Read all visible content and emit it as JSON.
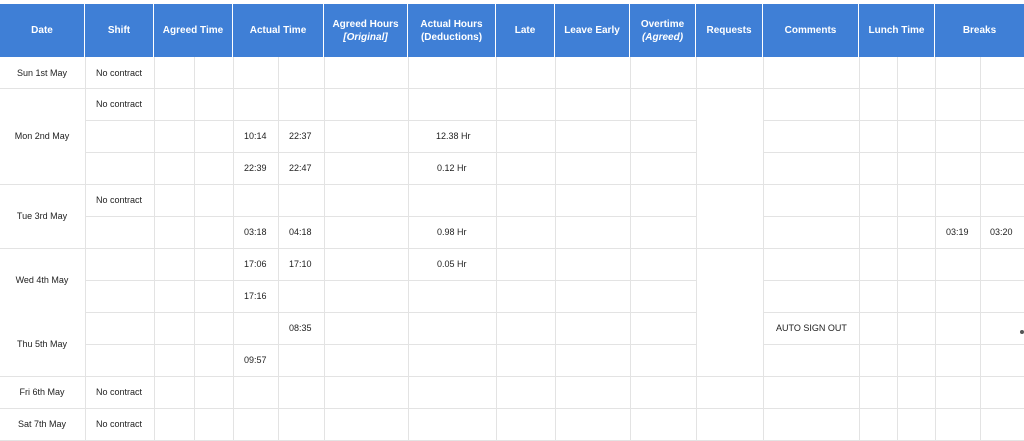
{
  "headers": {
    "date": "Date",
    "shift": "Shift",
    "agreed_time": "Agreed Time",
    "actual_time": "Actual Time",
    "agreed_hours": "Agreed Hours",
    "agreed_hours_sub": "[Original]",
    "actual_hours": "Actual Hours",
    "actual_hours_sub": "(Deductions)",
    "late": "Late",
    "leave_early": "Leave Early",
    "overtime": "Overtime",
    "overtime_sub": "(Agreed)",
    "requests": "Requests",
    "comments": "Comments",
    "lunch_time": "Lunch Time",
    "breaks": "Breaks"
  },
  "dates": {
    "sun": "Sun 1st May",
    "mon": "Mon 2nd May",
    "tue": "Tue 3rd May",
    "wed": "Wed 4th May",
    "thu": "Thu 5th May",
    "fri": "Fri 6th May",
    "sat": "Sat 7th May"
  },
  "shift": {
    "no_contract": "No contract"
  },
  "cells": {
    "mon_r2_in": "10:14",
    "mon_r2_out": "22:37",
    "mon_r2_hours": "12.38 Hr",
    "mon_r3_in": "22:39",
    "mon_r3_out": "22:47",
    "mon_r3_hours": "0.12 Hr",
    "tue_r2_in": "03:18",
    "tue_r2_out": "04:18",
    "tue_r2_hours": "0.98 Hr",
    "tue_r2_break_start": "03:19",
    "tue_r2_break_end": "03:20",
    "wed_r1_in": "17:06",
    "wed_r1_out": "17:10",
    "wed_r1_hours": "0.05 Hr",
    "wed_r2_in": "17:16",
    "thu_r1_out": "08:35",
    "thu_r1_comment": "AUTO SIGN OUT",
    "thu_r2_in": "09:57"
  }
}
